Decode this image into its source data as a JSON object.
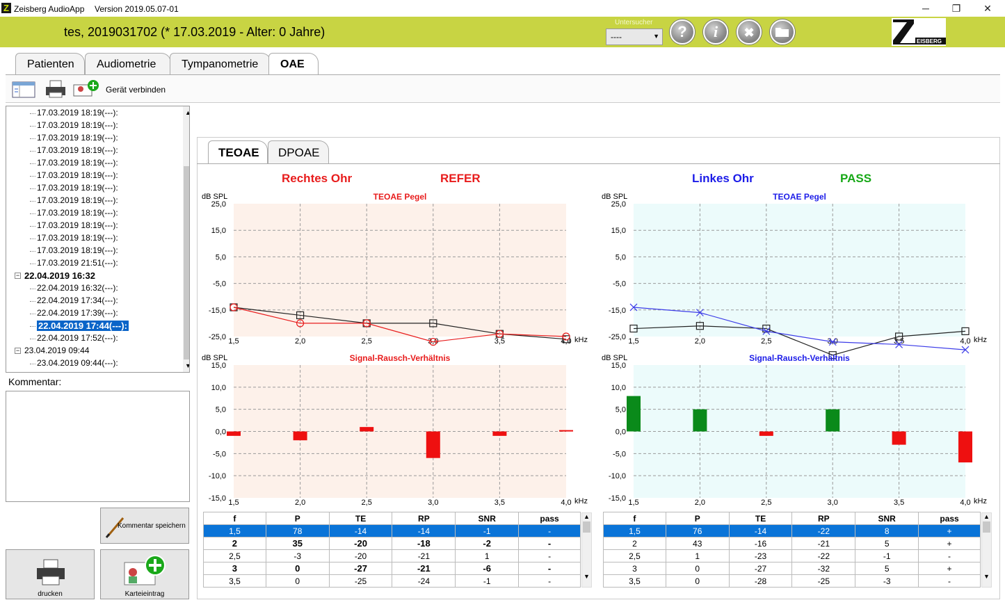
{
  "window": {
    "app_title": "Zeisberg AudioApp",
    "version": "Version 2019.05.07-01",
    "minimize": "─",
    "restore": "❐",
    "close": "✕"
  },
  "header": {
    "patient": "tes, 2019031702 (* 17.03.2019 - Alter: 0 Jahre)",
    "untersucher_label": "Untersucher",
    "untersucher_value": "----",
    "brand_text": "EISBERG"
  },
  "tabs": [
    "Patienten",
    "Audiometrie",
    "Tympanometrie",
    "OAE"
  ],
  "toolbar": {
    "connect_label": "Gerät verbinden"
  },
  "tree": {
    "items": [
      {
        "label": "17.03.2019 18:19(---):",
        "level": 2
      },
      {
        "label": "17.03.2019 18:19(---):",
        "level": 2
      },
      {
        "label": "17.03.2019 18:19(---):",
        "level": 2
      },
      {
        "label": "17.03.2019 18:19(---):",
        "level": 2
      },
      {
        "label": "17.03.2019 18:19(---):",
        "level": 2
      },
      {
        "label": "17.03.2019 18:19(---):",
        "level": 2
      },
      {
        "label": "17.03.2019 18:19(---):",
        "level": 2
      },
      {
        "label": "17.03.2019 18:19(---):",
        "level": 2
      },
      {
        "label": "17.03.2019 18:19(---):",
        "level": 2
      },
      {
        "label": "17.03.2019 18:19(---):",
        "level": 2
      },
      {
        "label": "17.03.2019 18:19(---):",
        "level": 2
      },
      {
        "label": "17.03.2019 18:19(---):",
        "level": 2
      },
      {
        "label": "17.03.2019 21:51(---):",
        "level": 2
      },
      {
        "label": "22.04.2019 16:32",
        "level": 1,
        "bold": true
      },
      {
        "label": "22.04.2019 16:32(---):",
        "level": 2
      },
      {
        "label": "22.04.2019 17:34(---):",
        "level": 2
      },
      {
        "label": "22.04.2019 17:39(---):",
        "level": 2
      },
      {
        "label": "22.04.2019 17:44(---):",
        "level": 2,
        "selected": true
      },
      {
        "label": "22.04.2019 17:52(---):",
        "level": 2
      },
      {
        "label": "23.04.2019 09:44",
        "level": 1
      },
      {
        "label": "23.04.2019 09:44(---):",
        "level": 2
      }
    ]
  },
  "kommentar": {
    "label": "Kommentar:",
    "save_label": "Kommentar speichern"
  },
  "buttons": {
    "print_label": "drucken",
    "karteieintrag_label": "Karteieintrag"
  },
  "oae_tabs": [
    "TEOAE",
    "DPOAE"
  ],
  "right_ear": {
    "title": "Rechtes Ohr",
    "result": "REFER",
    "color": "#e81c1c",
    "bg": "#fdf1ea"
  },
  "left_ear": {
    "title": "Linkes Ohr",
    "result": "PASS",
    "color": "#1c1ce8",
    "result_color": "#17a817",
    "bg": "#ecfbfb"
  },
  "chart_data": [
    {
      "type": "line",
      "title": "TEOAE Pegel",
      "ear": "right",
      "ylabel": "dB SPL",
      "xunit": "kHz",
      "ylim": [
        -25,
        25
      ],
      "yticks": [
        "25,0",
        "15,0",
        "5,0",
        "-5,0",
        "-15,0",
        "-25,0"
      ],
      "xticks": [
        "1,5",
        "2,0",
        "2,5",
        "3,0",
        "3,5",
        "4,0"
      ],
      "x": [
        1.5,
        2.0,
        2.5,
        3.0,
        3.5,
        4.0
      ],
      "series": [
        {
          "color": "#222",
          "marker": "square",
          "values": [
            -14,
            -17,
            -20,
            -20,
            -24,
            -26
          ]
        },
        {
          "color": "#e81c1c",
          "marker": "circle",
          "values": [
            -14,
            -20,
            -20,
            -27,
            -24,
            -25
          ]
        }
      ]
    },
    {
      "type": "bar",
      "title": "Signal-Rausch-Verhältnis",
      "ear": "right",
      "ylabel": "dB SPL",
      "xunit": "kHz",
      "ylim": [
        -15,
        15
      ],
      "yticks": [
        "15,0",
        "10,0",
        "5,0",
        "0,0",
        "-5,0",
        "-10,0",
        "-15,0"
      ],
      "xticks": [
        "1,5",
        "2,0",
        "2,5",
        "3,0",
        "3,5",
        "4,0"
      ],
      "x": [
        1.5,
        2.0,
        2.5,
        3.0,
        3.5,
        4.0
      ],
      "values": [
        -1,
        -2,
        1,
        -6,
        -1,
        0.3
      ],
      "pass": [
        false,
        false,
        false,
        false,
        false,
        false
      ]
    },
    {
      "type": "line",
      "title": "TEOAE Pegel",
      "ear": "left",
      "ylabel": "dB SPL",
      "xunit": "kHz",
      "ylim": [
        -25,
        25
      ],
      "yticks": [
        "25,0",
        "15,0",
        "5,0",
        "-5,0",
        "-15,0",
        "-25,0"
      ],
      "xticks": [
        "1,5",
        "2,0",
        "2,5",
        "3,0",
        "3,5",
        "4,0"
      ],
      "x": [
        1.5,
        2.0,
        2.5,
        3.0,
        3.5,
        4.0
      ],
      "series": [
        {
          "color": "#222",
          "marker": "square",
          "values": [
            -22,
            -21,
            -22,
            -32,
            -25,
            -23
          ]
        },
        {
          "color": "#3c3ce8",
          "marker": "x",
          "values": [
            -14,
            -16,
            -23,
            -27,
            -28,
            -30
          ]
        }
      ]
    },
    {
      "type": "bar",
      "title": "Signal-Rausch-Verhältnis",
      "ear": "left",
      "ylabel": "dB SPL",
      "xunit": "kHz",
      "ylim": [
        -15,
        15
      ],
      "yticks": [
        "15,0",
        "10,0",
        "5,0",
        "0,0",
        "-5,0",
        "-10,0",
        "-15,0"
      ],
      "xticks": [
        "1,5",
        "2,0",
        "2,5",
        "3,0",
        "3,5",
        "4,0"
      ],
      "x": [
        1.5,
        2.0,
        2.5,
        3.0,
        3.5,
        4.0
      ],
      "values": [
        8,
        5,
        -1,
        5,
        -3,
        -7
      ],
      "pass": [
        true,
        true,
        false,
        true,
        false,
        false
      ]
    }
  ],
  "table_columns": [
    "f",
    "P",
    "TE",
    "RP",
    "SNR",
    "pass"
  ],
  "right_table": [
    [
      "1,5",
      "78",
      "-14",
      "-14",
      "-1",
      "-"
    ],
    [
      "2",
      "35",
      "-20",
      "-18",
      "-2",
      "-"
    ],
    [
      "2,5",
      "-3",
      "-20",
      "-21",
      "1",
      "-"
    ],
    [
      "3",
      "0",
      "-27",
      "-21",
      "-6",
      "-"
    ],
    [
      "3,5",
      "0",
      "-25",
      "-24",
      "-1",
      "-"
    ]
  ],
  "left_table": [
    [
      "1,5",
      "76",
      "-14",
      "-22",
      "8",
      "+"
    ],
    [
      "2",
      "43",
      "-16",
      "-21",
      "5",
      "+"
    ],
    [
      "2,5",
      "1",
      "-23",
      "-22",
      "-1",
      "-"
    ],
    [
      "3",
      "0",
      "-27",
      "-32",
      "5",
      "+"
    ],
    [
      "3,5",
      "0",
      "-28",
      "-25",
      "-3",
      "-"
    ]
  ]
}
